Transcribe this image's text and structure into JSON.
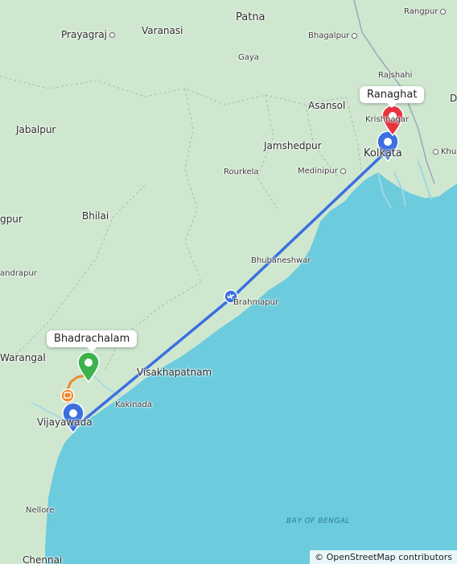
{
  "map": {
    "attribution": "© OpenStreetMap contributors",
    "sea_label": "BAY OF BENGAL",
    "colors": {
      "land": "#cfe7cf",
      "sea": "#6ccbdd",
      "route_flight": "#3b6fe0",
      "route_road": "#f08a2c",
      "origin_pin": "#3db24b",
      "destination_pin": "#e8333f",
      "station_pin": "#3b6fe0"
    }
  },
  "callouts": {
    "origin": "Bhadrachalam",
    "destination": "Ranaghat"
  },
  "places": {
    "patna": "Patna",
    "rangpur": "Rangpur",
    "prayagraj": "Prayagraj",
    "varanasi": "Varanasi",
    "bhagalpur": "Bhagalpur",
    "gaya": "Gaya",
    "rajshahi": "Rajshahi",
    "dhaka_partial": "D",
    "asansol": "Asansol",
    "krishnagar": "Krishnagar",
    "jabalpur": "Jabalpur",
    "jamshedpur": "Jamshedpur",
    "kolkata": "Kolkata",
    "khulna_partial": "Khu",
    "medinipur": "Medinipur",
    "rourkela": "Rourkela",
    "nagpur_partial": "gpur",
    "bhilai": "Bhilai",
    "bhubaneshwar": "Bhubaneshwar",
    "chandrapur_partial": "andrapur",
    "brahmapur": "Brahmapur",
    "warangal": "Warangal",
    "visakhapatnam": "Visakhapatnam",
    "kakinada": "Kakinada",
    "vijayawada": "Vijayawada",
    "nellore": "Nellore",
    "chennai_partial": "Chennai"
  }
}
